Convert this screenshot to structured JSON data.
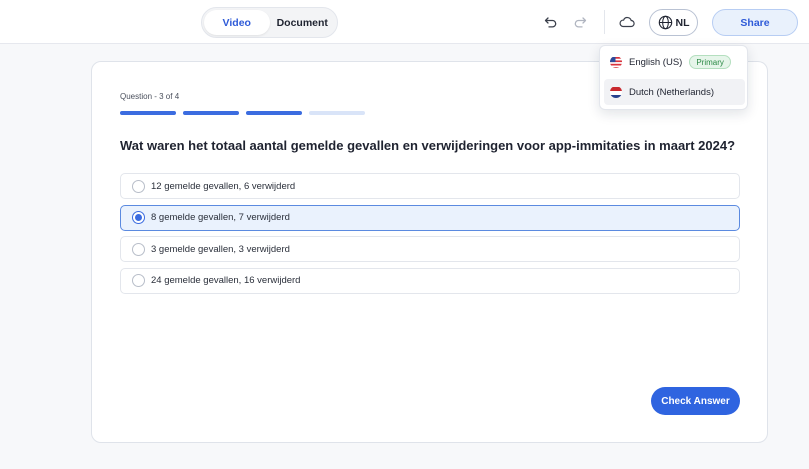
{
  "header": {
    "tabs": [
      {
        "label": "Video",
        "active": true
      },
      {
        "label": "Document",
        "active": false
      }
    ],
    "language_code": "NL",
    "share_label": "Share",
    "icons": [
      "undo-icon",
      "redo-icon",
      "cloud-icon",
      "globe-icon"
    ]
  },
  "language_menu": {
    "items": [
      {
        "label": "English (US)",
        "badge": "Primary",
        "flag": "us"
      },
      {
        "label": "Dutch (Netherlands)",
        "flag": "nl",
        "highlighted": true
      }
    ]
  },
  "quiz": {
    "counter": "Question - 3 of 4",
    "progress": {
      "total": 4,
      "completed": 3
    },
    "question": "Wat waren het totaal aantal gemelde gevallen en verwijderingen voor app-immitaties in maart 2024?",
    "options": [
      {
        "label": "12 gemelde gevallen, 6 verwijderd",
        "selected": false
      },
      {
        "label": "8 gemelde gevallen, 7 verwijderd",
        "selected": true
      },
      {
        "label": "3 gemelde gevallen, 3 verwijderd",
        "selected": false
      },
      {
        "label": "24 gemelde gevallen, 16 verwijderd",
        "selected": false
      }
    ],
    "check_label": "Check Answer"
  },
  "colors": {
    "accent": "#2f64e0",
    "selected_bg": "#eaf2fd",
    "badge_green": "#2c8a46"
  }
}
